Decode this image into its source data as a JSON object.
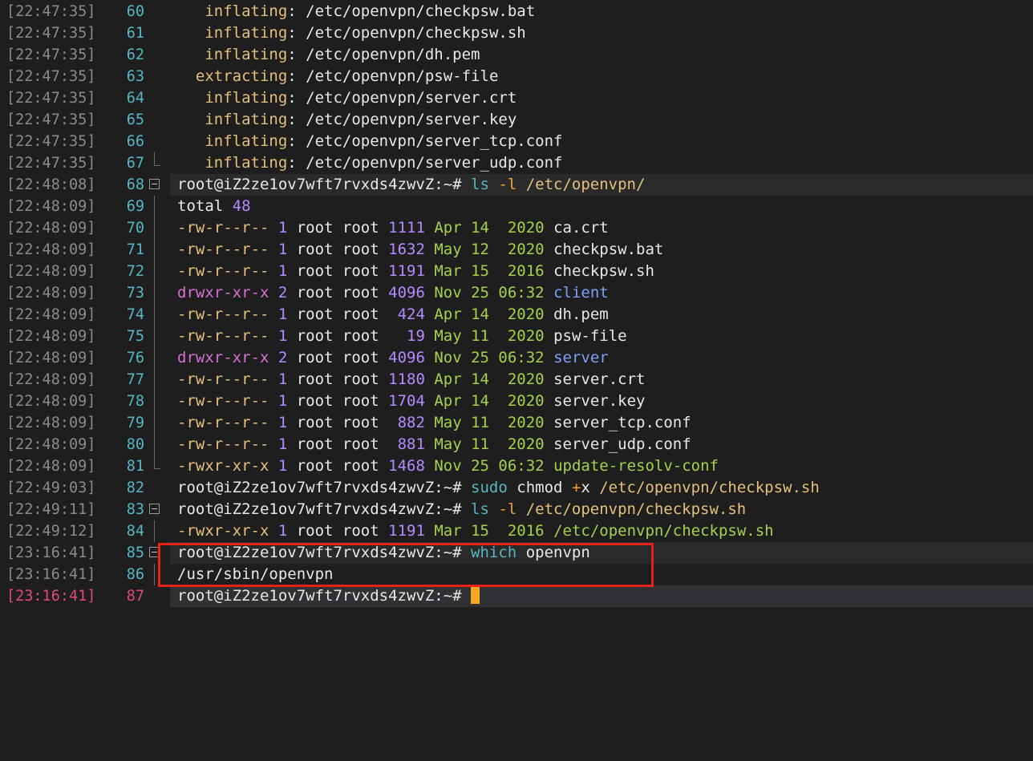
{
  "terminal": {
    "prompt": "root@iZ2ze1ov7wft7rvxds4zwvZ:~#",
    "colors": {
      "background": "#1e1e1e",
      "timestamp": "#8a8a8a",
      "line_number": "#56b6c2",
      "active": "#e0487a",
      "cursor": "#f5a623",
      "highlight_box": "#e8201a"
    },
    "lines": [
      {
        "ts": "[22:47:35]",
        "n": "60",
        "segs": [
          [
            "   ",
            "w"
          ],
          [
            "inflating",
            "y"
          ],
          [
            ": /etc/openvpn/checkpsw.bat",
            "w"
          ]
        ]
      },
      {
        "ts": "[22:47:35]",
        "n": "61",
        "segs": [
          [
            "   ",
            "w"
          ],
          [
            "inflating",
            "y"
          ],
          [
            ": /etc/openvpn/checkpsw.sh",
            "w"
          ]
        ]
      },
      {
        "ts": "[22:47:35]",
        "n": "62",
        "segs": [
          [
            "   ",
            "w"
          ],
          [
            "inflating",
            "y"
          ],
          [
            ": /etc/openvpn/dh.pem",
            "w"
          ]
        ]
      },
      {
        "ts": "[22:47:35]",
        "n": "63",
        "segs": [
          [
            "  ",
            "w"
          ],
          [
            "extracting",
            "y"
          ],
          [
            ": /etc/openvpn/psw-file",
            "w"
          ]
        ]
      },
      {
        "ts": "[22:47:35]",
        "n": "64",
        "segs": [
          [
            "   ",
            "w"
          ],
          [
            "inflating",
            "y"
          ],
          [
            ": /etc/openvpn/server.crt",
            "w"
          ]
        ]
      },
      {
        "ts": "[22:47:35]",
        "n": "65",
        "segs": [
          [
            "   ",
            "w"
          ],
          [
            "inflating",
            "y"
          ],
          [
            ": /etc/openvpn/server.key",
            "w"
          ]
        ]
      },
      {
        "ts": "[22:47:35]",
        "n": "66",
        "segs": [
          [
            "   ",
            "w"
          ],
          [
            "inflating",
            "y"
          ],
          [
            ": /etc/openvpn/server_tcp.conf",
            "w"
          ]
        ]
      },
      {
        "ts": "[22:47:35]",
        "n": "67",
        "segs": [
          [
            "   ",
            "w"
          ],
          [
            "inflating",
            "y"
          ],
          [
            ": /etc/openvpn/server_udp.conf",
            "w"
          ]
        ]
      },
      {
        "ts": "[22:48:08]",
        "n": "68",
        "segs": [
          [
            "root@iZ2ze1ov7wft7rvxds4zwvZ:~# ",
            "w"
          ],
          [
            "ls",
            "c"
          ],
          [
            " -l ",
            "o"
          ],
          [
            "/etc/openvpn/",
            "y"
          ]
        ]
      },
      {
        "ts": "[22:48:09]",
        "n": "69",
        "segs": [
          [
            "total ",
            "w"
          ],
          [
            "48",
            "p"
          ]
        ]
      },
      {
        "ts": "[22:48:09]",
        "n": "70",
        "segs": [
          [
            "-rw-r--r-- ",
            "y"
          ],
          [
            "1",
            "p"
          ],
          [
            " root root ",
            "w"
          ],
          [
            "1111",
            "p"
          ],
          [
            " Apr 14  2020 ",
            "g"
          ],
          [
            "ca.crt",
            "w"
          ]
        ]
      },
      {
        "ts": "[22:48:09]",
        "n": "71",
        "segs": [
          [
            "-rw-r--r-- ",
            "y"
          ],
          [
            "1",
            "p"
          ],
          [
            " root root ",
            "w"
          ],
          [
            "1632",
            "p"
          ],
          [
            " May 12  2020 ",
            "g"
          ],
          [
            "checkpsw.bat",
            "w"
          ]
        ]
      },
      {
        "ts": "[22:48:09]",
        "n": "72",
        "segs": [
          [
            "-rw-r--r-- ",
            "y"
          ],
          [
            "1",
            "p"
          ],
          [
            " root root ",
            "w"
          ],
          [
            "1191",
            "p"
          ],
          [
            " Mar 15  2016 ",
            "g"
          ],
          [
            "checkpsw.sh",
            "w"
          ]
        ]
      },
      {
        "ts": "[22:48:09]",
        "n": "73",
        "segs": [
          [
            "drwxr-xr-x ",
            "m"
          ],
          [
            "2",
            "p"
          ],
          [
            " root root ",
            "w"
          ],
          [
            "4096",
            "p"
          ],
          [
            " Nov 25 06:32 ",
            "g"
          ],
          [
            "client",
            "b"
          ]
        ]
      },
      {
        "ts": "[22:48:09]",
        "n": "74",
        "segs": [
          [
            "-rw-r--r-- ",
            "y"
          ],
          [
            "1",
            "p"
          ],
          [
            " root root  ",
            "w"
          ],
          [
            "424",
            "p"
          ],
          [
            " Apr 14  2020 ",
            "g"
          ],
          [
            "dh.pem",
            "w"
          ]
        ]
      },
      {
        "ts": "[22:48:09]",
        "n": "75",
        "segs": [
          [
            "-rw-r--r-- ",
            "y"
          ],
          [
            "1",
            "p"
          ],
          [
            " root root   ",
            "w"
          ],
          [
            "19",
            "p"
          ],
          [
            " May 11  2020 ",
            "g"
          ],
          [
            "psw-file",
            "w"
          ]
        ]
      },
      {
        "ts": "[22:48:09]",
        "n": "76",
        "segs": [
          [
            "drwxr-xr-x ",
            "m"
          ],
          [
            "2",
            "p"
          ],
          [
            " root root ",
            "w"
          ],
          [
            "4096",
            "p"
          ],
          [
            " Nov 25 06:32 ",
            "g"
          ],
          [
            "server",
            "b"
          ]
        ]
      },
      {
        "ts": "[22:48:09]",
        "n": "77",
        "segs": [
          [
            "-rw-r--r-- ",
            "y"
          ],
          [
            "1",
            "p"
          ],
          [
            " root root ",
            "w"
          ],
          [
            "1180",
            "p"
          ],
          [
            " Apr 14  2020 ",
            "g"
          ],
          [
            "server.crt",
            "w"
          ]
        ]
      },
      {
        "ts": "[22:48:09]",
        "n": "78",
        "segs": [
          [
            "-rw-r--r-- ",
            "y"
          ],
          [
            "1",
            "p"
          ],
          [
            " root root ",
            "w"
          ],
          [
            "1704",
            "p"
          ],
          [
            " Apr 14  2020 ",
            "g"
          ],
          [
            "server.key",
            "w"
          ]
        ]
      },
      {
        "ts": "[22:48:09]",
        "n": "79",
        "segs": [
          [
            "-rw-r--r-- ",
            "y"
          ],
          [
            "1",
            "p"
          ],
          [
            " root root  ",
            "w"
          ],
          [
            "882",
            "p"
          ],
          [
            " May 11  2020 ",
            "g"
          ],
          [
            "server_tcp.conf",
            "w"
          ]
        ]
      },
      {
        "ts": "[22:48:09]",
        "n": "80",
        "segs": [
          [
            "-rw-r--r-- ",
            "y"
          ],
          [
            "1",
            "p"
          ],
          [
            " root root  ",
            "w"
          ],
          [
            "881",
            "p"
          ],
          [
            " May 11  2020 ",
            "g"
          ],
          [
            "server_udp.conf",
            "w"
          ]
        ]
      },
      {
        "ts": "[22:48:09]",
        "n": "81",
        "segs": [
          [
            "-rwxr-xr-x ",
            "y"
          ],
          [
            "1",
            "p"
          ],
          [
            " root root ",
            "w"
          ],
          [
            "1468",
            "p"
          ],
          [
            " Nov 25 06:32 ",
            "g"
          ],
          [
            "update-resolv-conf",
            "g"
          ]
        ]
      },
      {
        "ts": "[22:49:03]",
        "n": "82",
        "segs": [
          [
            "root@iZ2ze1ov7wft7rvxds4zwvZ:~# ",
            "w"
          ],
          [
            "sudo",
            "c"
          ],
          [
            " chmod ",
            "w"
          ],
          [
            "+",
            "o"
          ],
          [
            "x ",
            "w"
          ],
          [
            "/etc/openvpn/checkpsw.sh",
            "y"
          ]
        ]
      },
      {
        "ts": "[22:49:11]",
        "n": "83",
        "segs": [
          [
            "root@iZ2ze1ov7wft7rvxds4zwvZ:~# ",
            "w"
          ],
          [
            "ls",
            "c"
          ],
          [
            " -l ",
            "o"
          ],
          [
            "/etc/openvpn/checkpsw.sh",
            "y"
          ]
        ]
      },
      {
        "ts": "[22:49:12]",
        "n": "84",
        "segs": [
          [
            "-rwxr-xr-x ",
            "y"
          ],
          [
            "1",
            "p"
          ],
          [
            " root root ",
            "w"
          ],
          [
            "1191",
            "p"
          ],
          [
            " Mar 15  2016 ",
            "g"
          ],
          [
            "/etc/openvpn/checkpsw.sh",
            "g"
          ]
        ]
      },
      {
        "ts": "[23:16:41]",
        "n": "85",
        "segs": [
          [
            "root@iZ2ze1ov7wft7rvxds4zwvZ:~# ",
            "w"
          ],
          [
            "which",
            "c"
          ],
          [
            " openvpn",
            "w"
          ]
        ]
      },
      {
        "ts": "[23:16:41]",
        "n": "86",
        "segs": [
          [
            "/usr/sbin/openvpn",
            "w"
          ]
        ]
      },
      {
        "ts": "[23:16:41]",
        "n": "87",
        "segs": [
          [
            "root@iZ2ze1ov7wft7rvxds4zwvZ:~# ",
            "w"
          ]
        ]
      }
    ]
  }
}
